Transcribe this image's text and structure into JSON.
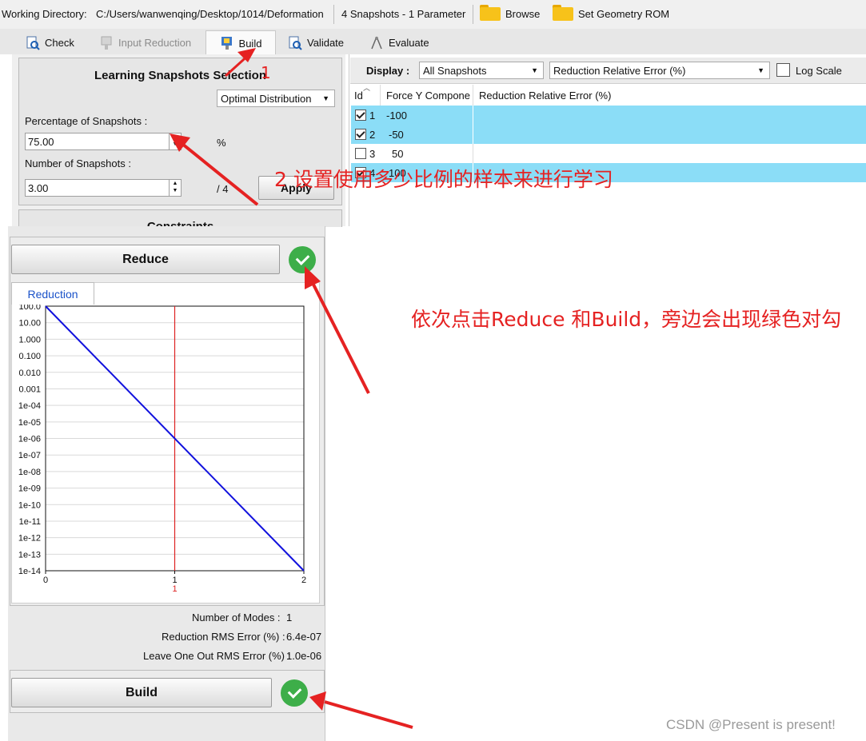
{
  "toolbar": {
    "working_dir_label": "Working Directory:",
    "working_dir_path": "C:/Users/wanwenqing/Desktop/1014/Deformation",
    "snapshots_info": "4 Snapshots - 1 Parameter",
    "browse": "Browse",
    "set_geometry": "Set Geometry ROM",
    "folder_icon": "folder-icon",
    "folder_color": "#f7c21a"
  },
  "tabs": [
    {
      "label": "Check",
      "icon": "check-doc-icon",
      "state": "normal"
    },
    {
      "label": "Input Reduction",
      "icon": "input-reduction-icon",
      "state": "disabled"
    },
    {
      "label": "Build",
      "icon": "build-icon",
      "state": "active"
    },
    {
      "label": "Validate",
      "icon": "validate-icon",
      "state": "normal"
    },
    {
      "label": "Evaluate",
      "icon": "evaluate-icon",
      "state": "normal"
    }
  ],
  "snapshot_selection": {
    "title": "Learning Snapshots Selection",
    "distribution": "Optimal Distribution",
    "percentage_label": "Percentage of Snapshots :",
    "percentage_value": "75.00",
    "percent_unit": "%",
    "number_label": "Number of Snapshots :",
    "number_value": "3.00",
    "number_total": "/ 4",
    "apply": "Apply",
    "constraints_partial": "Constraints"
  },
  "display_bar": {
    "label": "Display :",
    "filter": "All Snapshots",
    "metric": "Reduction Relative Error (%)",
    "log_scale": "Log Scale",
    "log_scale_checked": false
  },
  "grid": {
    "headers": [
      "Id",
      "Force Y Compone",
      "Reduction Relative Error (%)"
    ],
    "rows": [
      {
        "id": "1",
        "force": "-100",
        "checked": true,
        "highlight": true
      },
      {
        "id": "2",
        "force": "-50",
        "checked": true,
        "highlight": true
      },
      {
        "id": "3",
        "force": "50",
        "checked": false,
        "highlight": false
      },
      {
        "id": "4",
        "force": "100",
        "checked": true,
        "highlight": true
      }
    ],
    "highlight_color": "#8bddf7"
  },
  "reduce": {
    "button": "Reduce",
    "ok": true,
    "tab_label": "Reduction"
  },
  "chart_data": {
    "type": "line",
    "y_scale": "log",
    "ytick_labels": [
      "100.0",
      "10.00",
      "1.000",
      "0.100",
      "0.010",
      "0.001",
      "1e-04",
      "1e-05",
      "1e-06",
      "1e-07",
      "1e-08",
      "1e-09",
      "1e-10",
      "1e-11",
      "1e-12",
      "1e-13",
      "1e-14"
    ],
    "ylim": [
      1e-14,
      100
    ],
    "xlim": [
      0,
      2
    ],
    "xtick_labels": [
      "0",
      "1",
      "2"
    ],
    "series": [
      {
        "x": [
          0,
          2
        ],
        "y": [
          100,
          1e-14
        ],
        "color": "#1111dd"
      }
    ],
    "vline": {
      "x": 1,
      "label": "1",
      "color": "#d22"
    },
    "grid": true
  },
  "stats": {
    "modes_label": "Number of Modes :",
    "modes_value": "1",
    "rms_label": "Reduction RMS Error (%) :",
    "rms_value": "6.4e-07",
    "loo_label": "Leave One Out RMS Error (%) :",
    "loo_value": "1.0e-06"
  },
  "build": {
    "button": "Build",
    "ok": true
  },
  "annotations": {
    "step1": "1",
    "step2": "2 设置使用多少比例的样本来进行学习",
    "step3": "依次点击Reduce 和Build，旁边会出现绿色对勾",
    "color": "#e52222"
  },
  "watermark": "CSDN @Present is present!"
}
